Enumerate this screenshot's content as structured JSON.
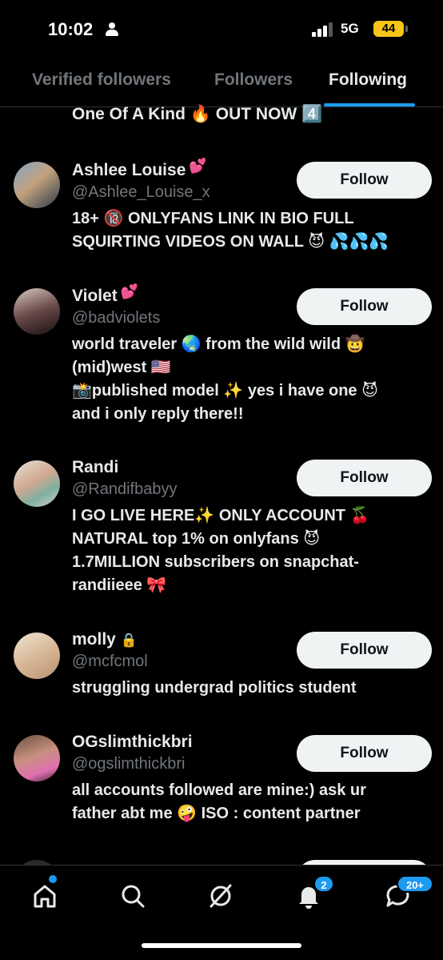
{
  "status_bar": {
    "time": "10:02",
    "network": "5G",
    "battery": "44"
  },
  "tabs": [
    {
      "label": "Verified followers"
    },
    {
      "label": "Followers"
    },
    {
      "label": "Following"
    }
  ],
  "previous_bio_tail": "One Of A Kind 🔥 OUT NOW 4️⃣",
  "accounts": [
    {
      "name": "Ashlee Louise",
      "name_emoji": "💕",
      "handle": "@Ashlee_Louise_x",
      "bio_lines": [
        "18+ 🔞 ONLYFANS LINK IN BIO FULL",
        "SQUIRTING VIDEOS ON WALL 😈 💦💦💦"
      ],
      "button": "Follow"
    },
    {
      "name": "Violet",
      "name_emoji": "💕",
      "handle": "@badviolets",
      "bio_lines": [
        "world traveler 🌏 from the wild wild 🤠",
        "(mid)west 🇺🇸",
        "📸published model ✨ yes i have one 😈",
        "and i only reply there!!"
      ],
      "button": "Follow"
    },
    {
      "name": "Randi",
      "name_emoji": "",
      "handle": "@Randifbabyy",
      "bio_lines": [
        "I GO LIVE HERE✨ ONLY ACCOUNT 🍒",
        "NATURAL top 1% on onlyfans 😈",
        "1.7MILLION subscribers on snapchat-",
        "randiieee 🎀"
      ],
      "button": "Follow"
    },
    {
      "name": "molly",
      "name_emoji": "🔒",
      "handle": "@mcfcmol",
      "bio_lines": [
        "struggling undergrad politics student"
      ],
      "button": "Follow"
    },
    {
      "name": "OGslimthickbri",
      "name_emoji": "",
      "handle": "@ogslimthickbri",
      "bio_lines": [
        "all accounts followed are mine:) ask ur",
        "father abt me 🤪 ISO : content partner"
      ],
      "button": "Follow"
    }
  ],
  "bottom_nav": {
    "notifications_badge": "2",
    "messages_badge": "20+"
  },
  "icons": [
    "home-icon",
    "search-icon",
    "grok-icon",
    "bell-icon",
    "messages-icon"
  ],
  "colors": {
    "accent": "#1d9bf0",
    "muted": "#71767b",
    "text": "#e7e9ea",
    "button_bg": "#eff3f4"
  }
}
